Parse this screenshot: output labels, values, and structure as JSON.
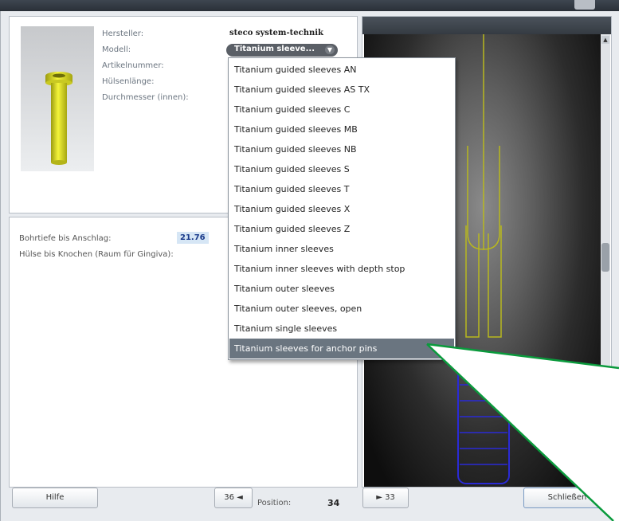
{
  "sleeve_panel": {
    "manufacturer_label": "Hersteller:",
    "manufacturer_value": "steco system-technik",
    "model_label": "Modell:",
    "model_value": "Titanium sleeve...",
    "article_label": "Artikelnummer:",
    "length_label": "Hülsenlänge:",
    "diameter_label": "Durchmesser (innen):"
  },
  "depth_panel": {
    "drill_depth_label": "Bohrtiefe bis Anschlag:",
    "drill_depth_value": "21.76",
    "gap_label": "Hülse bis Knochen (Raum für Gingiva):"
  },
  "dropdown": {
    "items": [
      "Titanium guided sleeves AN",
      "Titanium guided sleeves AS TX",
      "Titanium guided sleeves C",
      "Titanium guided sleeves MB",
      "Titanium guided sleeves NB",
      "Titanium guided sleeves S",
      "Titanium guided sleeves T",
      "Titanium guided sleeves X",
      "Titanium guided sleeves Z",
      "Titanium inner sleeves",
      "Titanium inner sleeves with depth stop",
      "Titanium outer sleeves",
      "Titanium outer sleeves, open",
      "Titanium single sleeves",
      "Titanium sleeves for anchor pins"
    ],
    "selected_index": 14
  },
  "footer": {
    "help_label": "Hilfe",
    "prev_label": "36 ◄",
    "position_label": "Position:",
    "position_value": "34",
    "next_label": "► 33",
    "close_label": "Schließen"
  },
  "colors": {
    "sleeve_yellow": "#e8e81a",
    "implant_blue": "#2a2ad6",
    "callout_green": "#0a9a3c",
    "guide_outline": "#b8b81e"
  }
}
